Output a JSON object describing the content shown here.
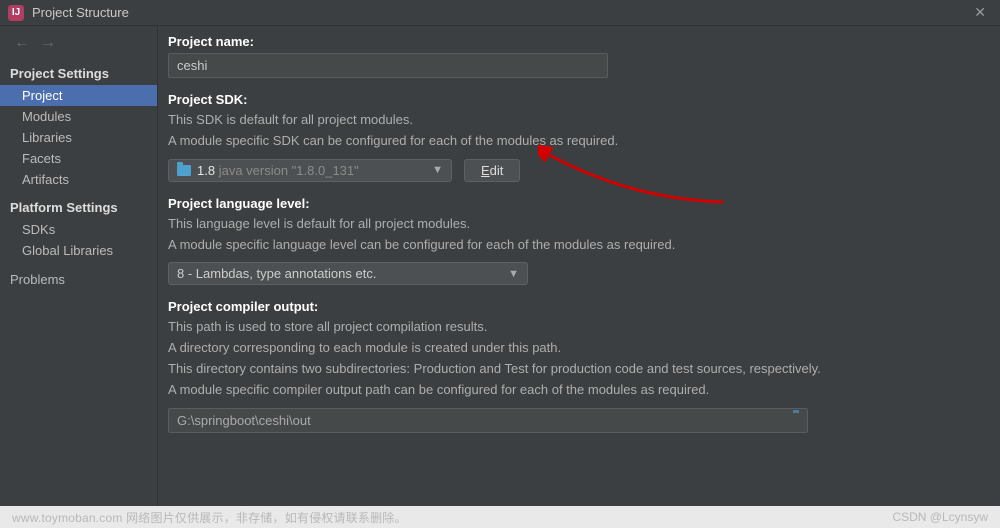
{
  "titlebar": {
    "title": "Project Structure"
  },
  "sidebar": {
    "group1_label": "Project Settings",
    "group1": [
      {
        "label": "Project",
        "selected": true
      },
      {
        "label": "Modules"
      },
      {
        "label": "Libraries"
      },
      {
        "label": "Facets"
      },
      {
        "label": "Artifacts"
      }
    ],
    "group2_label": "Platform Settings",
    "group2": [
      {
        "label": "SDKs"
      },
      {
        "label": "Global Libraries"
      }
    ],
    "group3": [
      {
        "label": "Problems"
      }
    ]
  },
  "project_name": {
    "label": "Project name:",
    "value": "ceshi"
  },
  "project_sdk": {
    "label": "Project SDK:",
    "desc1": "This SDK is default for all project modules.",
    "desc2": "A module specific SDK can be configured for each of the modules as required.",
    "version_bold": "1.8",
    "version_dim": "java version \"1.8.0_131\"",
    "edit_label_u": "E",
    "edit_label_rest": "dit"
  },
  "language_level": {
    "label": "Project language level:",
    "desc1": "This language level is default for all project modules.",
    "desc2": "A module specific language level can be configured for each of the modules as required.",
    "value": "8 - Lambdas, type annotations etc."
  },
  "compiler_output": {
    "label": "Project compiler output:",
    "desc1": "This path is used to store all project compilation results.",
    "desc2": "A directory corresponding to each module is created under this path.",
    "desc3": "This directory contains two subdirectories: Production and Test for production code and test sources, respectively.",
    "desc4": "A module specific compiler output path can be configured for each of the modules as required.",
    "value": "G:\\springboot\\ceshi\\out"
  },
  "footer": {
    "left": "www.toymoban.com 网络图片仅供展示，非存储，如有侵权请联系删除。",
    "right": "CSDN @Lcynsyw"
  }
}
